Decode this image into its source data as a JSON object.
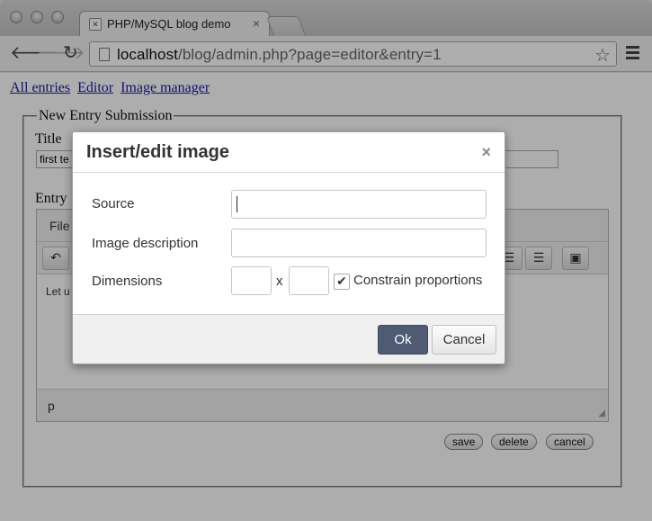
{
  "browser": {
    "tab_title": "PHP/MySQL blog demo",
    "tab_close": "×",
    "url_host": "localhost",
    "url_path": "/blog/admin.php?page=editor&entry=1",
    "back_icon": "arrow-left",
    "forward_icon": "arrow-right",
    "reload_icon": "reload",
    "star_icon": "star",
    "menu_icon": "hamburger"
  },
  "nav": {
    "links": [
      "All entries",
      "Editor",
      "Image manager"
    ]
  },
  "form": {
    "legend": "New Entry Submission",
    "title_label": "Title",
    "title_value": "first te",
    "entry_label": "Entry",
    "editor_menu_file": "File",
    "editor_body_text": "Let u",
    "editor_status_path": "p",
    "buttons": {
      "save": "save",
      "delete": "delete",
      "cancel": "cancel"
    }
  },
  "dialog": {
    "title": "Insert/edit image",
    "close": "×",
    "source_label": "Source",
    "source_value": "",
    "description_label": "Image description",
    "description_value": "",
    "dimensions_label": "Dimensions",
    "width_value": "",
    "height_value": "",
    "times": "x",
    "constrain_label": "Constrain proportions",
    "constrain_checked": true,
    "ok_label": "Ok",
    "cancel_label": "Cancel",
    "ok_color": "#4e5b72"
  }
}
